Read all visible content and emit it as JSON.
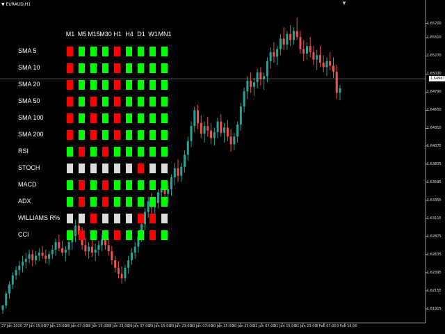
{
  "window": {
    "symbol_title": "EURAUD,H1"
  },
  "price_axis": {
    "labels": [
      "1.65700",
      "1.65510",
      "1.65270",
      "1.65030",
      "1.64790",
      "1.64550",
      "1.64310",
      "1.64075",
      "1.63835",
      "1.63595",
      "1.63355",
      "1.63115",
      "1.62875",
      "1.62635",
      "1.62395",
      "1.62155",
      "1.61915"
    ],
    "current_price": "1.64967"
  },
  "time_axis": {
    "labels": [
      "27 Jan 2020",
      "27 Jan 15:00",
      "27 Jan 23:00",
      "28 Jan 07:00",
      "28 Jan 15:00",
      "28 Jan 23:00",
      "29 Jan 07:00",
      "29 Jan 15:00",
      "29 Jan 23:00",
      "30 Jan 07:00",
      "30 Jan 15:00",
      "30 Jan 23:00",
      "31 Jan 07:00",
      "31 Jan 15:00",
      "31 Jan 23:00",
      "3 Feb 07:00",
      "3 Feb 15:00"
    ]
  },
  "colors": {
    "green": "#00ff00",
    "red": "#ff0000",
    "neutral": "#dcdcdc",
    "bull": "#26a69a",
    "bear": "#ef5350",
    "background": "#000000"
  },
  "dashboard": {
    "timeframes": [
      "M1",
      "M5",
      "M15",
      "M30",
      "H1",
      "H4",
      "D1",
      "W1",
      "MN1"
    ],
    "rows": [
      {
        "name": "SMA 5",
        "signals": [
          "r",
          "g",
          "g",
          "g",
          "r",
          "g",
          "g",
          "g",
          "g"
        ]
      },
      {
        "name": "SMA 10",
        "signals": [
          "r",
          "g",
          "g",
          "g",
          "r",
          "g",
          "g",
          "g",
          "g"
        ]
      },
      {
        "name": "SMA 20",
        "signals": [
          "r",
          "g",
          "g",
          "g",
          "r",
          "g",
          "g",
          "g",
          "g"
        ]
      },
      {
        "name": "SMA 50",
        "signals": [
          "r",
          "g",
          "r",
          "g",
          "r",
          "g",
          "g",
          "g",
          "g"
        ]
      },
      {
        "name": "SMA 100",
        "signals": [
          "r",
          "g",
          "r",
          "g",
          "r",
          "g",
          "g",
          "g",
          "g"
        ]
      },
      {
        "name": "SMA 200",
        "signals": [
          "r",
          "g",
          "r",
          "g",
          "r",
          "g",
          "g",
          "g",
          "g"
        ]
      },
      {
        "name": "RSI",
        "signals": [
          "g",
          "r",
          "g",
          "r",
          "g",
          "g",
          "g",
          "g",
          "g"
        ]
      },
      {
        "name": "STOCH",
        "signals": [
          "w",
          "w",
          "w",
          "w",
          "w",
          "w",
          "r",
          "w",
          "w"
        ]
      },
      {
        "name": "MACD",
        "signals": [
          "g",
          "r",
          "g",
          "r",
          "g",
          "g",
          "g",
          "g",
          "g"
        ]
      },
      {
        "name": "ADX",
        "signals": [
          "g",
          "r",
          "g",
          "r",
          "g",
          "g",
          "g",
          "g",
          "g"
        ]
      },
      {
        "name": "WILLIAMS R%",
        "signals": [
          "w",
          "w",
          "r",
          "w",
          "w",
          "w",
          "r",
          "r",
          "w"
        ]
      },
      {
        "name": "CCI",
        "signals": [
          "g",
          "r",
          "g",
          "g",
          "r",
          "g",
          "g",
          "r",
          "g"
        ]
      }
    ]
  },
  "candles": [
    [
      1.619,
      1.6197,
      1.6185,
      1.6196
    ],
    [
      1.6196,
      1.6215,
      1.6192,
      1.6212
    ],
    [
      1.6212,
      1.6228,
      1.6205,
      1.6224
    ],
    [
      1.6224,
      1.624,
      1.6218,
      1.6236
    ],
    [
      1.6236,
      1.6248,
      1.623,
      1.6243
    ],
    [
      1.6243,
      1.6255,
      1.6236,
      1.6249
    ],
    [
      1.6249,
      1.6262,
      1.624,
      1.6254
    ],
    [
      1.6254,
      1.6266,
      1.6245,
      1.6258
    ],
    [
      1.6258,
      1.627,
      1.6252,
      1.6264
    ],
    [
      1.6264,
      1.627,
      1.6248,
      1.6256
    ],
    [
      1.6256,
      1.6268,
      1.625,
      1.6262
    ],
    [
      1.6262,
      1.6272,
      1.6255,
      1.6266
    ],
    [
      1.6266,
      1.6275,
      1.6258,
      1.6262
    ],
    [
      1.6262,
      1.627,
      1.6252,
      1.6258
    ],
    [
      1.6258,
      1.6268,
      1.625,
      1.6264
    ],
    [
      1.6264,
      1.6276,
      1.6258,
      1.627
    ],
    [
      1.627,
      1.6285,
      1.6262,
      1.628
    ],
    [
      1.628,
      1.629,
      1.6268,
      1.6272
    ],
    [
      1.6272,
      1.6282,
      1.6262,
      1.6266
    ],
    [
      1.6266,
      1.6275,
      1.6255,
      1.627
    ],
    [
      1.627,
      1.6285,
      1.6262,
      1.628
    ],
    [
      1.628,
      1.6295,
      1.627,
      1.6288
    ],
    [
      1.6288,
      1.631,
      1.628,
      1.6302
    ],
    [
      1.6302,
      1.6315,
      1.6285,
      1.629
    ],
    [
      1.629,
      1.63,
      1.627,
      1.6276
    ],
    [
      1.6276,
      1.6286,
      1.6262,
      1.6268
    ],
    [
      1.6268,
      1.628,
      1.6258,
      1.6274
    ],
    [
      1.6274,
      1.6285,
      1.626,
      1.6266
    ],
    [
      1.6266,
      1.6278,
      1.6255,
      1.627
    ],
    [
      1.627,
      1.6282,
      1.6262,
      1.6276
    ],
    [
      1.6276,
      1.629,
      1.6268,
      1.6284
    ],
    [
      1.6284,
      1.6295,
      1.627,
      1.6276
    ],
    [
      1.6276,
      1.6286,
      1.6262,
      1.6268
    ],
    [
      1.6268,
      1.6275,
      1.625,
      1.6256
    ],
    [
      1.6256,
      1.6262,
      1.624,
      1.6246
    ],
    [
      1.6246,
      1.6255,
      1.6232,
      1.6238
    ],
    [
      1.6238,
      1.6248,
      1.6225,
      1.6232
    ],
    [
      1.6232,
      1.625,
      1.6228,
      1.6246
    ],
    [
      1.6246,
      1.6262,
      1.6238,
      1.6256
    ],
    [
      1.6256,
      1.6272,
      1.625,
      1.6266
    ],
    [
      1.6266,
      1.628,
      1.6258,
      1.6274
    ],
    [
      1.6274,
      1.6292,
      1.6266,
      1.6288
    ],
    [
      1.6288,
      1.631,
      1.628,
      1.6304
    ],
    [
      1.6304,
      1.6325,
      1.6296,
      1.632
    ],
    [
      1.632,
      1.634,
      1.6312,
      1.6334
    ],
    [
      1.6334,
      1.6345,
      1.6318,
      1.6326
    ],
    [
      1.6326,
      1.6338,
      1.6315,
      1.6332
    ],
    [
      1.6332,
      1.635,
      1.6325,
      1.6346
    ],
    [
      1.6346,
      1.636,
      1.6336,
      1.6352
    ],
    [
      1.6352,
      1.6358,
      1.6338,
      1.6344
    ],
    [
      1.6344,
      1.6355,
      1.6332,
      1.635
    ],
    [
      1.635,
      1.637,
      1.6342,
      1.6366
    ],
    [
      1.6366,
      1.6385,
      1.6355,
      1.6378
    ],
    [
      1.6378,
      1.639,
      1.636,
      1.6368
    ],
    [
      1.6368,
      1.6385,
      1.636,
      1.638
    ],
    [
      1.638,
      1.6402,
      1.6372,
      1.6396
    ],
    [
      1.6396,
      1.642,
      1.6388,
      1.6414
    ],
    [
      1.6414,
      1.644,
      1.6406,
      1.6434
    ],
    [
      1.6434,
      1.646,
      1.6426,
      1.6455
    ],
    [
      1.6455,
      1.6462,
      1.643,
      1.6438
    ],
    [
      1.6438,
      1.6448,
      1.6418,
      1.6424
    ],
    [
      1.6424,
      1.644,
      1.6412,
      1.6434
    ],
    [
      1.6434,
      1.6446,
      1.642,
      1.6428
    ],
    [
      1.6428,
      1.6438,
      1.641,
      1.6418
    ],
    [
      1.6418,
      1.6432,
      1.6408,
      1.6426
    ],
    [
      1.6426,
      1.6445,
      1.6418,
      1.644
    ],
    [
      1.644,
      1.645,
      1.642,
      1.6425
    ],
    [
      1.6425,
      1.6438,
      1.6412,
      1.6432
    ],
    [
      1.6432,
      1.6442,
      1.6414,
      1.642
    ],
    [
      1.642,
      1.643,
      1.64,
      1.641
    ],
    [
      1.641,
      1.6425,
      1.6402,
      1.642
    ],
    [
      1.642,
      1.644,
      1.6412,
      1.6436
    ],
    [
      1.6436,
      1.6465,
      1.6428,
      1.646
    ],
    [
      1.646,
      1.6485,
      1.6452,
      1.648
    ],
    [
      1.648,
      1.65,
      1.647,
      1.6494
    ],
    [
      1.6494,
      1.6505,
      1.6478,
      1.6486
    ],
    [
      1.6486,
      1.6498,
      1.6474,
      1.6492
    ],
    [
      1.6492,
      1.651,
      1.6484,
      1.6505
    ],
    [
      1.6505,
      1.6512,
      1.6488,
      1.6496
    ],
    [
      1.6496,
      1.6505,
      1.6482,
      1.65
    ],
    [
      1.65,
      1.6525,
      1.6492,
      1.652
    ],
    [
      1.652,
      1.6538,
      1.651,
      1.6532
    ],
    [
      1.6532,
      1.6545,
      1.6518,
      1.6526
    ],
    [
      1.6526,
      1.654,
      1.6515,
      1.6536
    ],
    [
      1.6536,
      1.6556,
      1.6528,
      1.655
    ],
    [
      1.655,
      1.6565,
      1.6535,
      1.6542
    ],
    [
      1.6542,
      1.656,
      1.6535,
      1.6556
    ],
    [
      1.6556,
      1.6568,
      1.654,
      1.6548
    ],
    [
      1.6548,
      1.6565,
      1.6542,
      1.656
    ],
    [
      1.656,
      1.6578,
      1.6548,
      1.6552
    ],
    [
      1.6552,
      1.656,
      1.653,
      1.6536
    ],
    [
      1.6536,
      1.6548,
      1.652,
      1.653
    ],
    [
      1.653,
      1.6545,
      1.6522,
      1.654
    ],
    [
      1.654,
      1.6552,
      1.6525,
      1.6532
    ],
    [
      1.6532,
      1.654,
      1.6515,
      1.6522
    ],
    [
      1.6522,
      1.6535,
      1.6508,
      1.6528
    ],
    [
      1.6528,
      1.654,
      1.6512,
      1.6518
    ],
    [
      1.6518,
      1.6528,
      1.6505,
      1.6512
    ],
    [
      1.6512,
      1.6525,
      1.65,
      1.652
    ],
    [
      1.652,
      1.6532,
      1.6508,
      1.6514
    ],
    [
      1.6514,
      1.6525,
      1.6498,
      1.6506
    ],
    [
      1.6506,
      1.6515,
      1.647,
      1.6478
    ],
    [
      1.6478,
      1.6488,
      1.6468,
      1.6484
    ]
  ]
}
